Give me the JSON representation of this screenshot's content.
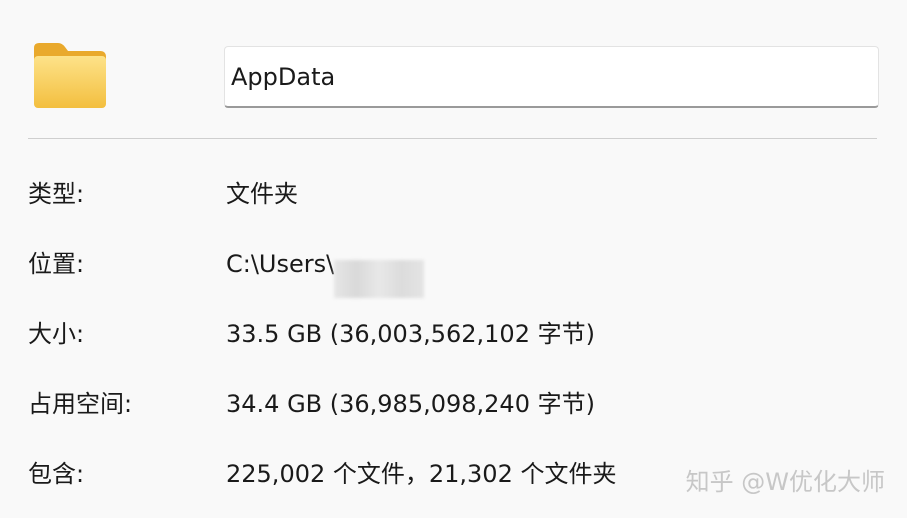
{
  "folder": {
    "icon": "folder-icon",
    "icon_color": "#f5c84c",
    "name": "AppData"
  },
  "properties": [
    {
      "label": "类型:",
      "value": "文件夹"
    },
    {
      "label": "位置:",
      "value": "C:\\Users\\"
    },
    {
      "label": "大小:",
      "value": "33.5 GB (36,003,562,102 字节)"
    },
    {
      "label": "占用空间:",
      "value": "34.4 GB (36,985,098,240 字节)"
    },
    {
      "label": "包含:",
      "value": "225,002 个文件，21,302 个文件夹"
    }
  ],
  "watermark": "知乎 @W优化大师"
}
